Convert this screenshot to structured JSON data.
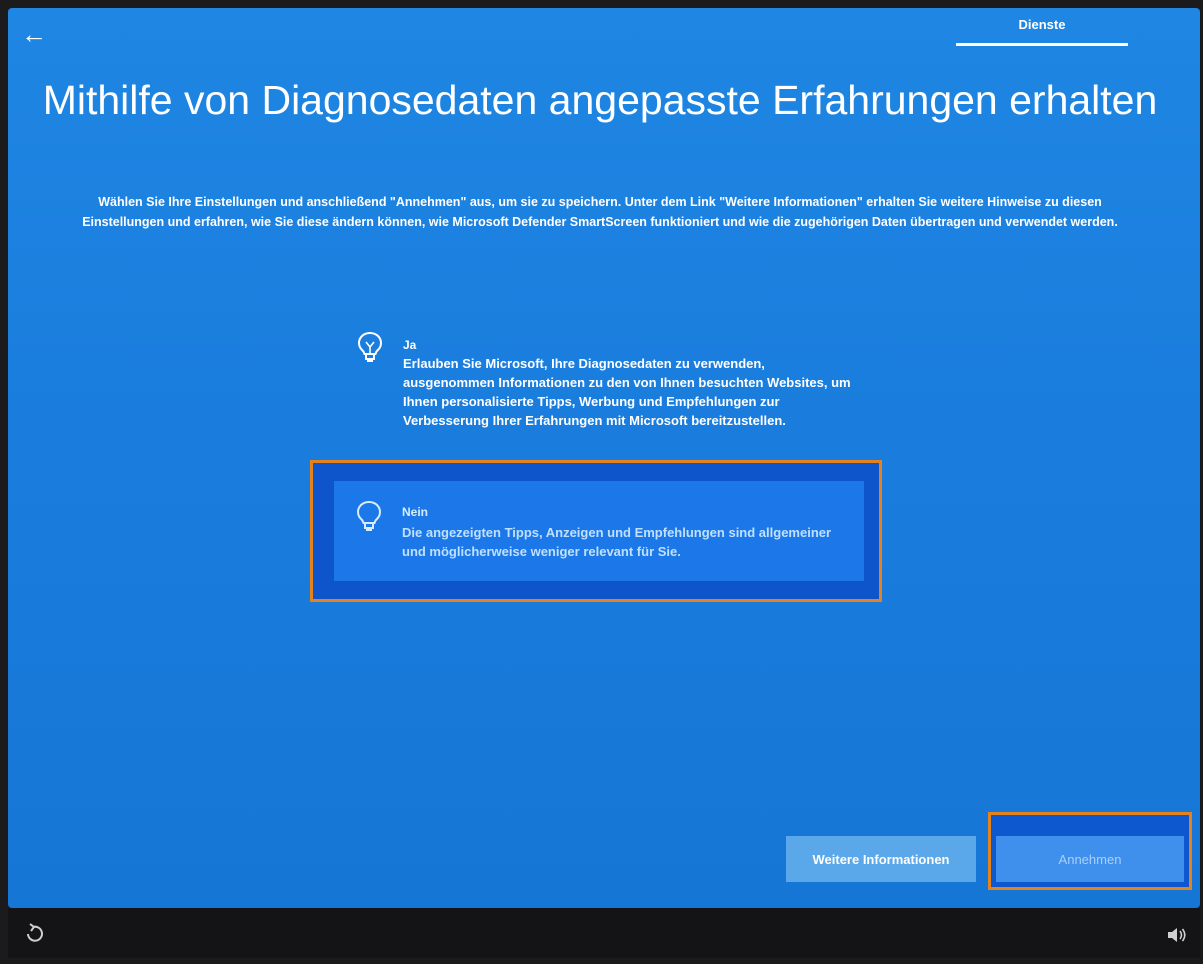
{
  "header": {
    "back_icon": "arrow-left-icon",
    "tab_label": "Dienste"
  },
  "main": {
    "title": "Mithilfe von Diagnosedaten angepasste Erfahrungen erhalten",
    "description": "Wählen Sie Ihre Einstellungen und anschließend \"Annehmen\" aus, um sie zu speichern. Unter dem Link \"Weitere Informationen\" erhalten Sie weitere Hinweise zu diesen Einstellungen und erfahren, wie Sie diese ändern können, wie Microsoft Defender SmartScreen funktioniert und wie die zugehörigen Daten übertragen und verwendet werden.",
    "options": [
      {
        "title": "Ja",
        "description": "Erlauben Sie Microsoft, Ihre Diagnosedaten zu verwenden, ausgenommen Informationen zu den von Ihnen besuchten Websites, um Ihnen personalisierte Tipps, Werbung und Empfehlungen zur Verbesserung Ihrer Erfahrungen mit Microsoft bereitzustellen.",
        "icon": "lightbulb-lit-icon",
        "selected": false
      },
      {
        "title": "Nein",
        "description": "Die angezeigten Tipps, Anzeigen und Empfehlungen sind allgemeiner und möglicherweise weniger relevant für Sie.",
        "icon": "lightbulb-icon",
        "selected": true
      }
    ]
  },
  "footer": {
    "more_info_label": "Weitere Informationen",
    "accept_label": "Annehmen"
  },
  "taskbar": {
    "accessibility_icon": "ease-of-access-icon",
    "volume_icon": "volume-icon"
  },
  "colors": {
    "background": "#1a7ddd",
    "highlight_border": "#e4831e",
    "selected_option": "#1c78e8",
    "more_info_button": "#5aa7ea",
    "accept_button": "#3f8fec"
  }
}
